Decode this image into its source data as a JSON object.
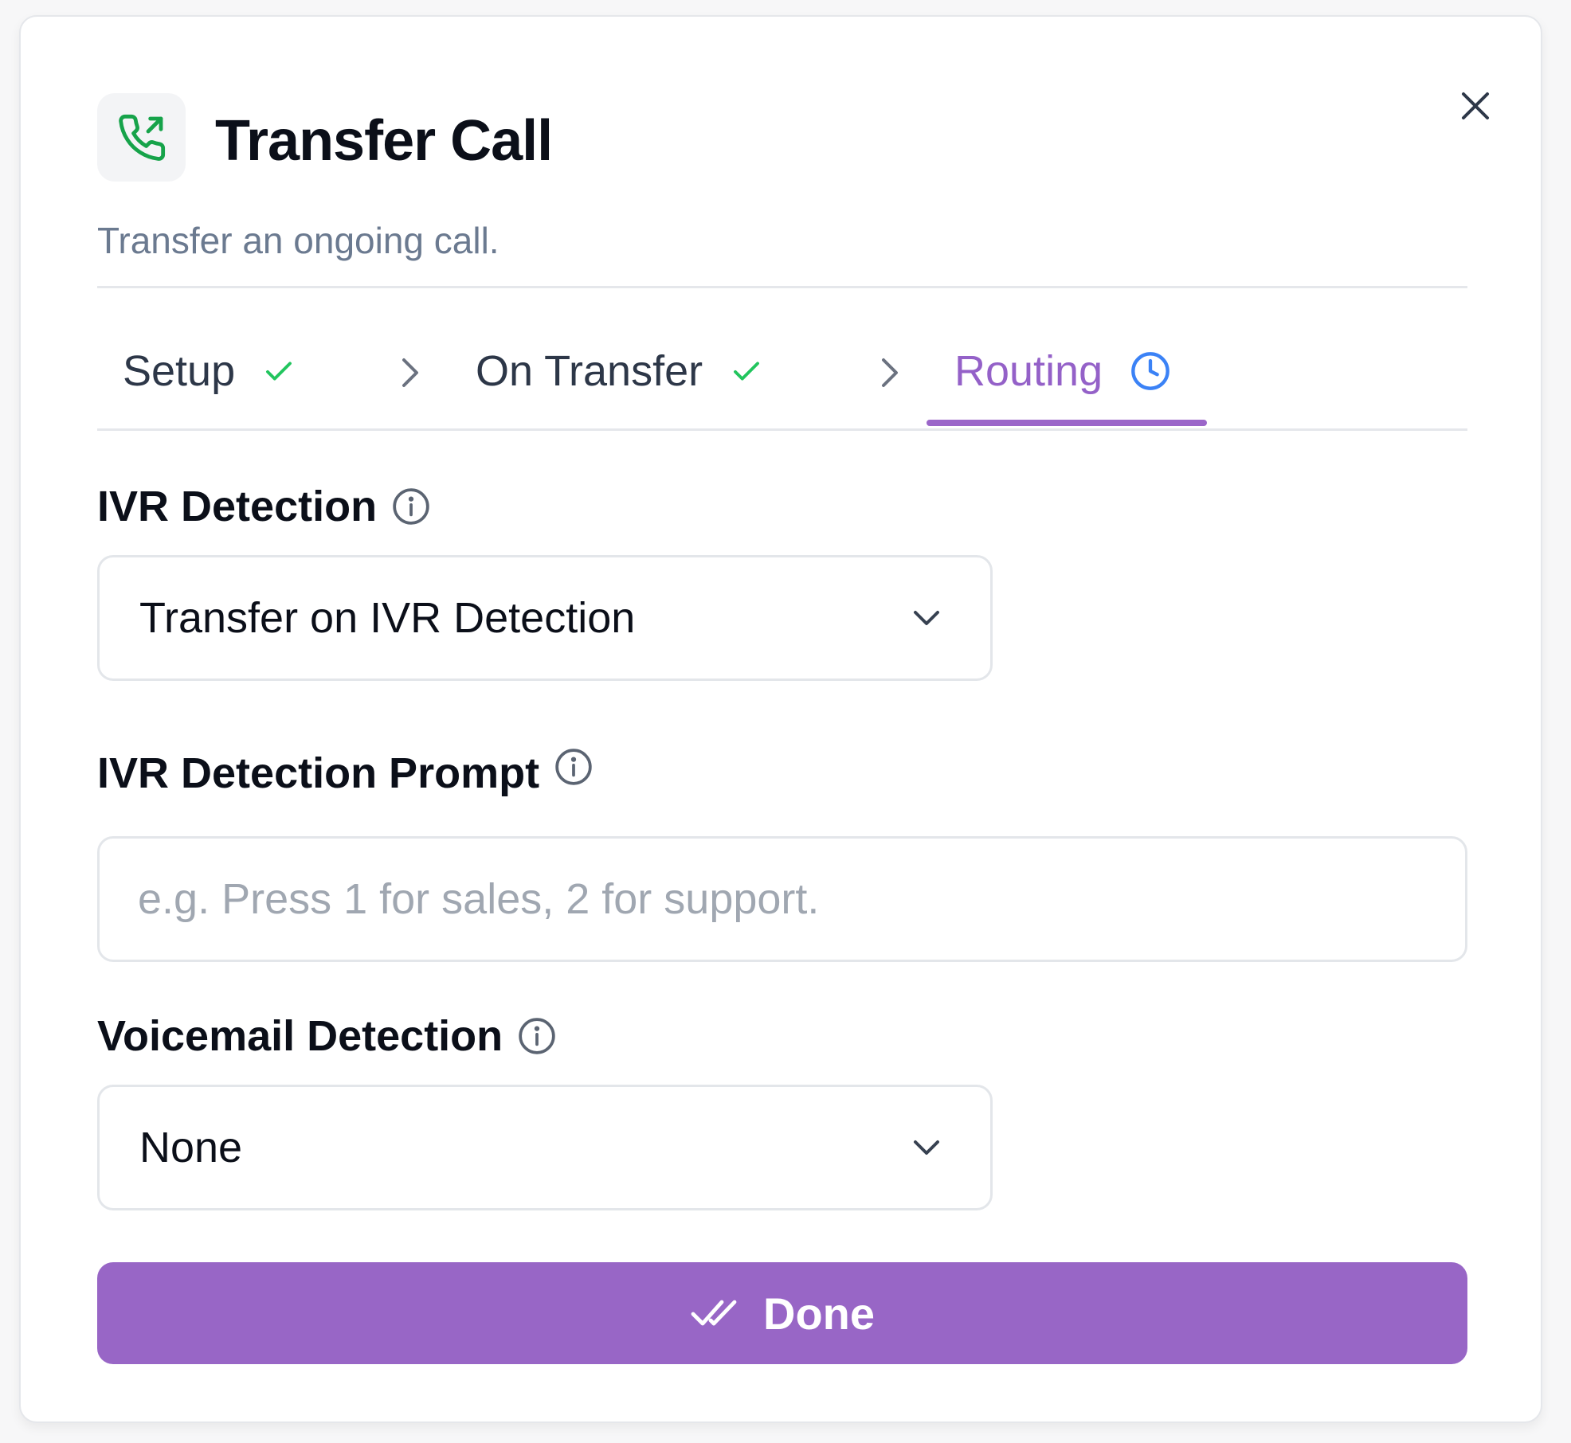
{
  "header": {
    "title": "Transfer Call",
    "subtitle": "Transfer an ongoing call.",
    "icon": "phone-forward-icon",
    "icon_color": "#16a34a"
  },
  "tabs": [
    {
      "label": "Setup",
      "status": "complete",
      "icon": "check-icon"
    },
    {
      "label": "On Transfer",
      "status": "complete",
      "icon": "check-icon"
    },
    {
      "label": "Routing",
      "status": "active",
      "icon": "clock-icon"
    }
  ],
  "fields": {
    "ivr_detection": {
      "label": "IVR Detection",
      "value": "Transfer on IVR Detection"
    },
    "ivr_prompt": {
      "label": "IVR Detection Prompt",
      "placeholder": "e.g. Press 1 for sales, 2 for support.",
      "value": ""
    },
    "voicemail_detection": {
      "label": "Voicemail Detection",
      "value": "None"
    }
  },
  "actions": {
    "done_label": "Done"
  },
  "colors": {
    "accent": "#9866c6",
    "active_tab": "#9461c8",
    "check": "#22c55e",
    "clock": "#3b82f6"
  }
}
